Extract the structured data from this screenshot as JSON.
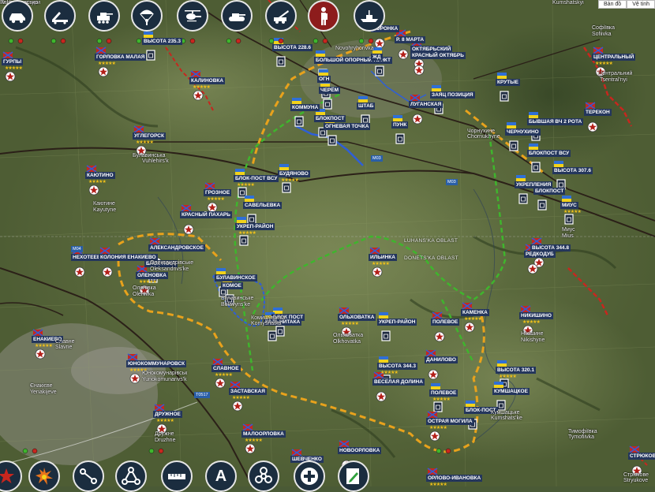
{
  "map_type": {
    "map": "Bản đồ",
    "satellite": "Vệ tinh"
  },
  "toolbar_top": [
    {
      "name": "armored-car-icon"
    },
    {
      "name": "missile-launcher-icon"
    },
    {
      "name": "artillery-vehicle-icon"
    },
    {
      "name": "paratrooper-icon"
    },
    {
      "name": "helicopter-icon"
    },
    {
      "name": "tank-icon"
    },
    {
      "name": "howitzer-icon"
    },
    {
      "name": "soldier-icon",
      "active": true
    },
    {
      "name": "warship-icon"
    }
  ],
  "toolbar_bottom": [
    {
      "name": "star-icon"
    },
    {
      "name": "explosion-icon"
    },
    {
      "name": "route-icon"
    },
    {
      "name": "network-icon"
    },
    {
      "name": "ruler-icon"
    },
    {
      "name": "text-icon",
      "text": "A"
    },
    {
      "name": "biohazard-icon"
    },
    {
      "name": "medical-cross-icon"
    },
    {
      "name": "edit-icon"
    }
  ],
  "colors": {
    "blue": "#2f5fd6",
    "yellow": "#e8a21c",
    "green": "#3fb52d",
    "red": "#c8261e",
    "label": "#24365c",
    "star": "#f2c21a"
  },
  "positions": [
    {
      "text": "ГУРПЫ",
      "side": "dnr",
      "stars": "★★★★★"
    },
    {
      "text": "ГОРЛОВКА МАЛАЯ",
      "side": "dnr",
      "stars": "★★★★★"
    },
    {
      "text": "ВЫСОТА 235.3",
      "side": "ua"
    },
    {
      "text": "ВЫСОТА 228.6",
      "side": "ua"
    },
    {
      "text": "КАЛИНОВКА",
      "side": "dnr",
      "stars": "★★★★★"
    },
    {
      "text": "ВОРОНКА",
      "side": "dnr"
    },
    {
      "text": "Р. 8 МАРТА",
      "side": "dnr"
    },
    {
      "text": "ОКТЯБРЬСКИЙ",
      "side": "dnr"
    },
    {
      "text": "КРАСНЫЙ ОКТЯБРЬ",
      "side": "dnr"
    },
    {
      "text": "ЦЕНТРАЛЬНЫЙ",
      "side": "dnr",
      "stars": "★★★★★"
    },
    {
      "text": "БОЛЬШОЙ ОПОРНЫЙ ПУНКТ",
      "side": "ua"
    },
    {
      "text": "ОГН",
      "side": "ua"
    },
    {
      "text": "ЧЕРЁМ",
      "side": "ua"
    },
    {
      "text": "ЖД",
      "side": "ua"
    },
    {
      "text": "ЗАЯЦ ПОЗИЦИЯ",
      "side": "ua"
    },
    {
      "text": "КРУТЫЕ",
      "side": "ua"
    },
    {
      "text": "КОММУНА",
      "side": "ua"
    },
    {
      "text": "ШТАБ",
      "side": "ua"
    },
    {
      "text": "ОГНЕВАЯ ТОЧКА",
      "side": "ua"
    },
    {
      "text": "БЛОКПОСТ",
      "side": "ua"
    },
    {
      "text": "ЛУГАНСКАЯ",
      "side": "dnr"
    },
    {
      "text": "ПУНК",
      "side": "ua"
    },
    {
      "text": "ТЕРЕКОН",
      "side": "dnr"
    },
    {
      "text": "УГЛЕГОРСК",
      "side": "dnr",
      "stars": "★★★★★"
    },
    {
      "text": "КАЮТИНО",
      "side": "dnr",
      "stars": "★★★★★"
    },
    {
      "text": "ЧЕРНУХИНО",
      "side": "ua"
    },
    {
      "text": "БЫВШАЯ ВЧ 2 РОТА",
      "side": "ua"
    },
    {
      "text": "БЛОКПОСТ ВСУ",
      "side": "ua"
    },
    {
      "text": "ВЫСОТА 307.6",
      "side": "ua"
    },
    {
      "text": "УКРЕПЛЕНИЯ",
      "side": "ua"
    },
    {
      "text": "БЛОКПОСТ",
      "side": "ua"
    },
    {
      "text": "МИУС",
      "side": "ua",
      "stars": "★★★★★"
    },
    {
      "text": "БЛОК-ПОСТ ВСУ",
      "side": "ua",
      "stars": "★★★★★"
    },
    {
      "text": "БУДЯНОВО",
      "side": "ua",
      "stars": "★★★★★"
    },
    {
      "text": "ГРОЗНОЕ",
      "side": "dnr",
      "stars": "★★★★★"
    },
    {
      "text": "САВЕЛЬЕВКА",
      "side": "ua"
    },
    {
      "text": "КРАСНЫЙ ПАХАРЬ",
      "side": "dnr"
    },
    {
      "text": "УКРЕП-РАЙОН",
      "side": "ua",
      "stars": "★★★★★"
    },
    {
      "text": "НЕХОТЕЕВКА",
      "side": "dnr"
    },
    {
      "text": "КОЛОНИЯ ЕНАКИЕВО",
      "side": "dnr"
    },
    {
      "text": "АЛЕКСАНДРОВСКОЕ",
      "side": "dnr"
    },
    {
      "text": "БЛОК ПОСТ",
      "side": "ua"
    },
    {
      "text": "ОЛЕНОВКА",
      "side": "dnr",
      "stars": "★★★★★"
    },
    {
      "text": "ИЛЬИНКА",
      "side": "dnr",
      "stars": "★★★★★"
    },
    {
      "text": "ВЫСОТА 344.8",
      "side": "dnr"
    },
    {
      "text": "РЕДКОДУБ",
      "side": "dnr"
    },
    {
      "text": "БУЛАВИНСКОЕ",
      "side": "ua"
    },
    {
      "text": "КОМОЕ",
      "side": "ua"
    },
    {
      "text": "БЛОК ПОСТ",
      "side": "ua"
    },
    {
      "text": "КАЛЬНИТАКА",
      "side": "ua"
    },
    {
      "text": "КАМЕНКА",
      "side": "dnr",
      "stars": "★★★★★"
    },
    {
      "text": "НИКИШИНО",
      "side": "dnr",
      "stars": "★★★★★"
    },
    {
      "text": "ОЛЬХОВАТКА",
      "side": "dnr",
      "stars": "★★★★★"
    },
    {
      "text": "УКРЕП-РАЙОН",
      "side": "ua"
    },
    {
      "text": "ПОЛЕВОЕ",
      "side": "dnr"
    },
    {
      "text": "ЕНАКИЕВО",
      "side": "dnr",
      "stars": "★★★★★"
    },
    {
      "text": "ЮНОКОММУНАРОВСК",
      "side": "dnr",
      "stars": "★★★★★"
    },
    {
      "text": "ВЫСОТА 344.3",
      "side": "ua",
      "stars": "★★★★★"
    },
    {
      "text": "ДАНИЛОВО",
      "side": "dnr"
    },
    {
      "text": "ВЫСОТА 320.1",
      "side": "ua",
      "stars": "★★★★★"
    },
    {
      "text": "ВЕСЕЛАЯ ДОЛИНА",
      "side": "dnr"
    },
    {
      "text": "КУМШАЦКОЕ",
      "side": "ua"
    },
    {
      "text": "СЛАВНОЕ",
      "side": "dnr",
      "stars": "★★★★★"
    },
    {
      "text": "ЗАСТАВСКАЯ",
      "side": "dnr",
      "stars": "★★★★★"
    },
    {
      "text": "ПОЛЕВОЕ",
      "side": "ua",
      "stars": "★★★★★"
    },
    {
      "text": "БЛОК-ПОСТ",
      "side": "ua"
    },
    {
      "text": "ОСТРАЯ МОГИЛА",
      "side": "dnr",
      "stars": "★★★★★"
    },
    {
      "text": "ДРУЖНОЕ",
      "side": "dnr",
      "stars": "★★★★★"
    },
    {
      "text": "МАЛООРЛОВКА",
      "side": "dnr",
      "stars": "★★★★★"
    },
    {
      "text": "НОВООРЛОВКА",
      "side": "dnr"
    },
    {
      "text": "ШЕВЧЕНКО",
      "side": "dnr"
    },
    {
      "text": "ОРЛОВО-ИВАНОВКА",
      "side": "dnr",
      "stars": "★★★★★"
    },
    {
      "text": "СТРЮКОВО",
      "side": "dnr"
    }
  ],
  "places": [
    {
      "text": "Софіївка"
    },
    {
      "text": "Sofiivka"
    },
    {
      "text": "Центральний"
    },
    {
      "text": "Tsentral'nyi"
    },
    {
      "text": "Novohryhorivka"
    },
    {
      "text": "Kumshatskyi"
    },
    {
      "text": "Булавинська"
    },
    {
      "text": "Vuhlehirs'k"
    },
    {
      "text": "Каютине"
    },
    {
      "text": "Kayutyne"
    },
    {
      "text": "Чорнухине"
    },
    {
      "text": "Chornukhyne"
    },
    {
      "text": "Олександрівське"
    },
    {
      "text": "Oleksandrivs'ke"
    },
    {
      "text": "Оленівка"
    },
    {
      "text": "Olenivka"
    },
    {
      "text": "Булавинське"
    },
    {
      "text": "Bulavyns'ke"
    },
    {
      "text": "Комишуватка"
    },
    {
      "text": "Komyshatka"
    },
    {
      "text": "Ольховатка"
    },
    {
      "text": "Olkhovatka"
    },
    {
      "text": "Миус"
    },
    {
      "text": "Mius"
    },
    {
      "text": "Нікішине"
    },
    {
      "text": "Nikishyne"
    },
    {
      "text": "Єнакієве"
    },
    {
      "text": "Yenakijeve"
    },
    {
      "text": "Юнокомунарівськ"
    },
    {
      "text": "Yunokomunarivs'k"
    },
    {
      "text": "Кумшацьке"
    },
    {
      "text": "Kumshats'ke"
    },
    {
      "text": "Тимофіївка"
    },
    {
      "text": "Tymofiivka"
    },
    {
      "text": "Дружне"
    },
    {
      "text": "Druzhne"
    },
    {
      "text": "Стрюкове"
    },
    {
      "text": "Stryukove"
    },
    {
      "text": "Славне"
    },
    {
      "text": "Slavne"
    },
    {
      "text": "Палац культури"
    },
    {
      "text": "Ім Ціолковсько"
    }
  ],
  "roads": [
    "M04",
    "M03",
    "M03",
    "T0517"
  ],
  "oblasts": [
    "LUHANS'KA OBLAST",
    "DONETS'KA OBLAST"
  ]
}
